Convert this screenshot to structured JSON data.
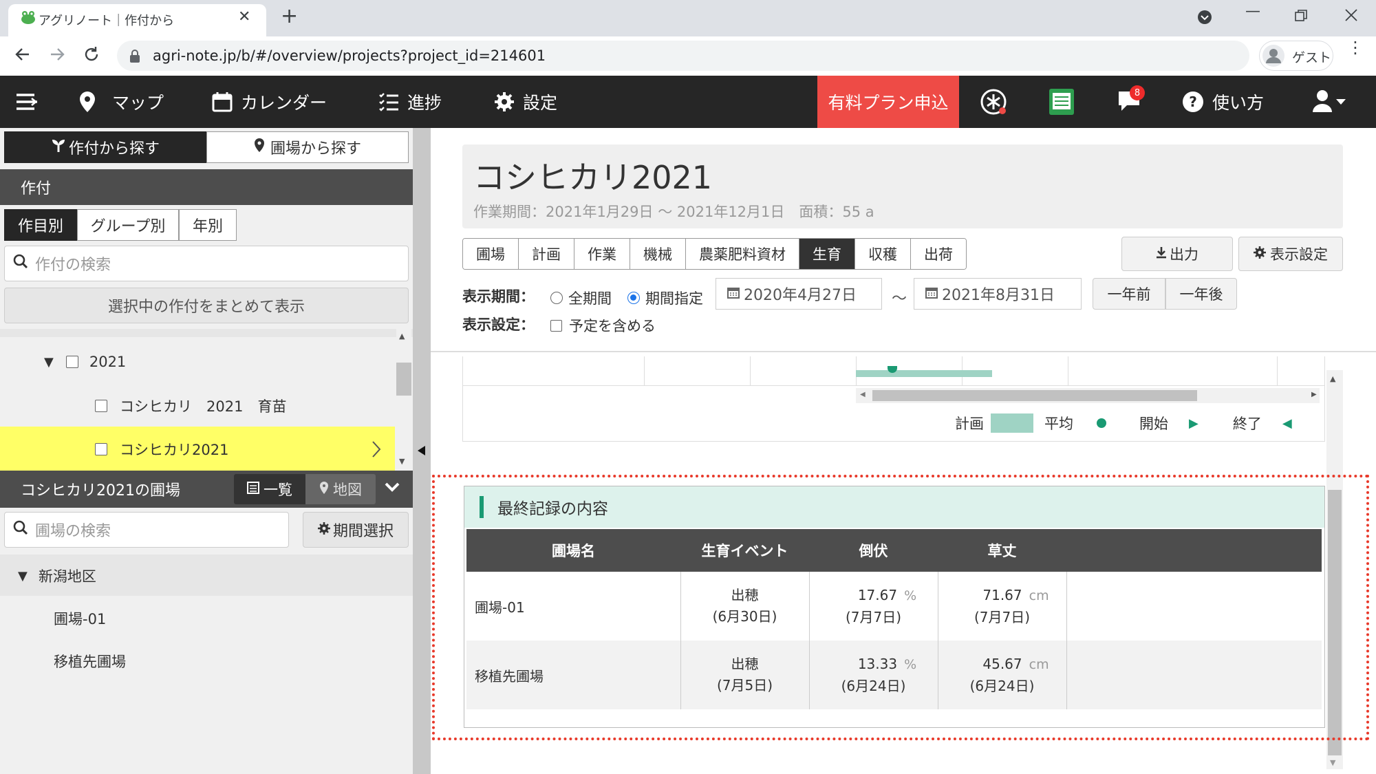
{
  "browser": {
    "tab_title": "アグリノート｜作付から",
    "tab_close": "✕",
    "new_tab": "+",
    "url": "agri-note.jp/b/#/overview/projects?project_id=214601",
    "profile_label": "ゲスト"
  },
  "nav": {
    "map": "マップ",
    "calendar": "カレンダー",
    "progress": "進捗",
    "settings": "設定",
    "paid_plan": "有料プラン申込",
    "notification_count": "8",
    "help": "使い方"
  },
  "left": {
    "search_tabs": [
      "作付から探す",
      "圃場から探す"
    ],
    "section_title": "作付",
    "filter_tabs": [
      "作目別",
      "グループ別",
      "年別"
    ],
    "crop_search_placeholder": "作付の検索",
    "show_selected": "選択中の作付をまとめて表示",
    "tree": {
      "year": "2021",
      "items": [
        "コシヒカリ　2021　育苗",
        "コシヒカリ2021"
      ]
    },
    "fields_title": "コシヒカリ2021の圃場",
    "view_tabs": [
      "一覧",
      "地図"
    ],
    "field_search_placeholder": "圃場の検索",
    "period_select": "期間選択",
    "region": "新潟地区",
    "fields": [
      "圃場-01",
      "移植先圃場"
    ]
  },
  "main": {
    "title": "コシヒカリ2021",
    "subtitle": "作業期間：2021年1月29日 ～ 2021年12月1日　面積：55 a",
    "tabs": [
      "圃場",
      "計画",
      "作業",
      "機械",
      "農薬肥料資材",
      "生育",
      "収穫",
      "出荷"
    ],
    "active_tab": "生育",
    "export": "出力",
    "display_settings": "表示設定",
    "period_label": "表示期間：",
    "period_all": "全期間",
    "period_range": "期間指定",
    "date_from": "2020年4月27日",
    "tilde": "～",
    "date_to": "2021年8月31日",
    "prev_year": "一年前",
    "next_year": "一年後",
    "settings_label": "表示設定：",
    "include_plan": "予定を含める",
    "legend": {
      "plan": "計画",
      "avg": "平均",
      "start": "開始",
      "end": "終了"
    }
  },
  "record": {
    "title": "最終記録の内容",
    "headers": [
      "圃場名",
      "生育イベント",
      "倒伏",
      "草丈"
    ],
    "rows": [
      {
        "field": "圃場-01",
        "event": "出穂",
        "event_date": "(6月30日)",
        "lodging": "17.67",
        "lodging_unit": "%",
        "lodging_date": "(7月7日)",
        "height": "71.67",
        "height_unit": "cm",
        "height_date": "(7月7日)"
      },
      {
        "field": "移植先圃場",
        "event": "出穂",
        "event_date": "(7月5日)",
        "lodging": "13.33",
        "lodging_unit": "%",
        "lodging_date": "(6月24日)",
        "height": "45.67",
        "height_unit": "cm",
        "height_date": "(6月24日)"
      }
    ]
  },
  "colors": {
    "nav_bg": "#262626",
    "paid_bg": "#ee4b46",
    "accent_green": "#1a9a73",
    "highlight_yellow": "#ffff66",
    "dotted_red": "#e8392a"
  }
}
